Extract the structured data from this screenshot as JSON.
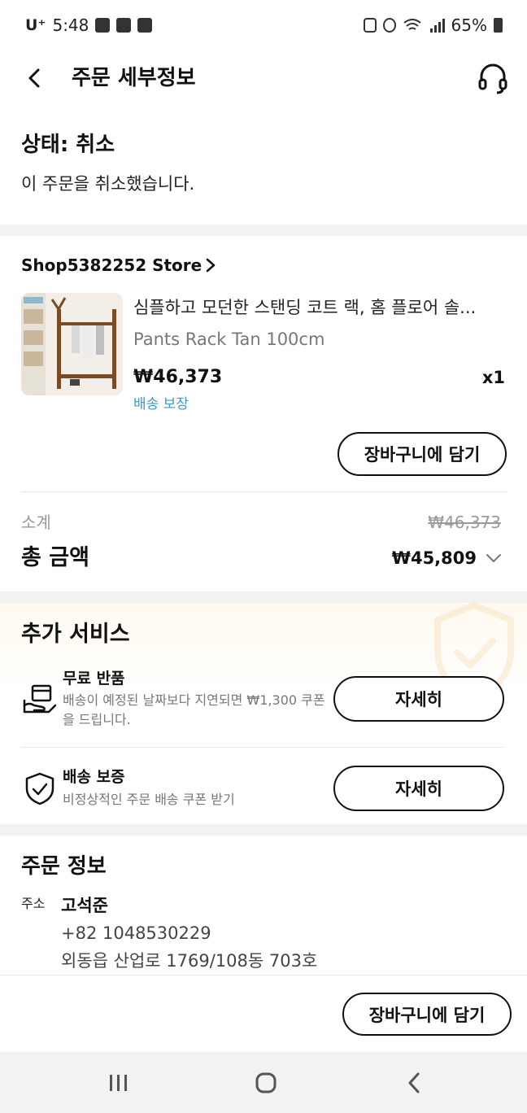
{
  "status_bar": {
    "carrier": "U⁺",
    "time": "5:48",
    "battery": "65%"
  },
  "header": {
    "title": "주문 세부정보"
  },
  "order_status": {
    "title": "상태: 취소",
    "description": "이 주문을 취소했습니다."
  },
  "store": {
    "name": "Shop5382252 Store"
  },
  "product": {
    "title": "심플하고 모던한 스탠딩 코트 랙, 홈 플로어 솔...",
    "variant": "Pants Rack Tan 100cm",
    "price": "₩46,373",
    "quantity": "x1",
    "shipping_tag": "배송 보장",
    "add_to_cart_label": "장바구니에 담기"
  },
  "summary": {
    "subtotal_label": "소계",
    "subtotal_value": "₩46,373",
    "total_label": "총 금액",
    "total_value": "₩45,809"
  },
  "services": {
    "title": "추가 서비스",
    "items": [
      {
        "title": "무료 반품",
        "description": "배송이 예정된 날짜보다 지연되면 ₩1,300 쿠폰을 드립니다.",
        "button_label": "자세히",
        "icon": "free-return-icon"
      },
      {
        "title": "배송 보증",
        "description": "비정상적인 주문 배송 쿠폰 받기",
        "button_label": "자세히",
        "icon": "shield-check-icon"
      }
    ]
  },
  "order_info": {
    "title": "주문 정보",
    "address_label": "주소",
    "recipient_name": "고석준",
    "phone": "+82 1048530229",
    "address_line": "외동읍 산업로 1769/108동 703호"
  },
  "bottom_bar": {
    "add_to_cart_label": "장바구니에 담기"
  },
  "colors": {
    "accent_link": "#3f9bbf",
    "section_gap": "#f2f2f2",
    "muted_text": "#999999"
  }
}
